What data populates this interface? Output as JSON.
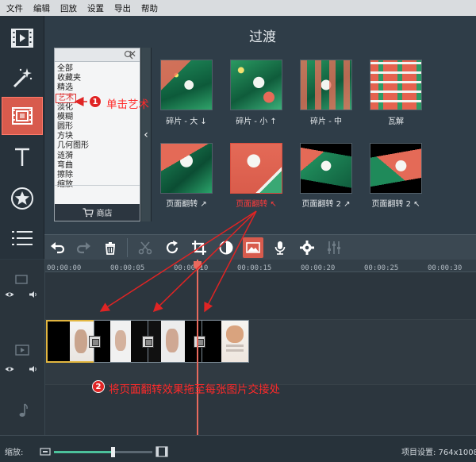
{
  "menu": [
    "文件",
    "编辑",
    "回放",
    "设置",
    "导出",
    "帮助"
  ],
  "left_tools": [
    "film-icon",
    "magic-wand-icon",
    "transition-icon",
    "text-icon",
    "star-icon",
    "list-icon"
  ],
  "panel": {
    "title": "过渡",
    "categories": [
      "全部",
      "收藏夹",
      "精选",
      "艺术",
      "淡化",
      "模糊",
      "圆形",
      "方块",
      "几何图形",
      "涟漪",
      "弯曲",
      "擦除",
      "缩放"
    ],
    "selected_category": "艺术",
    "shop_label": "商店",
    "collapse_arrow": "‹",
    "transitions": [
      {
        "label": "碎片 - 大 ↓"
      },
      {
        "label": "碎片 - 小 ↑"
      },
      {
        "label": "碎片 - 中"
      },
      {
        "label": "瓦解"
      },
      {
        "label": "页面翻转 ↗"
      },
      {
        "label": "页面翻转 ↖"
      },
      {
        "label": "页面翻转 2 ↗"
      },
      {
        "label": "页面翻转 2 ↖"
      }
    ]
  },
  "edit_tools": [
    "undo-icon",
    "redo-icon",
    "delete-icon",
    "cut-icon",
    "rotate-icon",
    "crop-icon",
    "color-adjust-icon",
    "image-icon",
    "microphone-icon",
    "settings-icon",
    "equalizer-icon"
  ],
  "timeline": {
    "ticks": [
      "00:00:00",
      "00:00:05",
      "00:00:10",
      "00:00:15",
      "00:00:20",
      "00:00:25",
      "00:00:30"
    ]
  },
  "status": {
    "zoom_label": "缩放:",
    "zoom_fraction": 0.6,
    "project_settings": "项目设置: 764x1008"
  },
  "annotations": {
    "step1_num": "1",
    "step1_text": "单击艺术",
    "step2_num": "2",
    "step2_text": "将页面翻转效果拖至每张图片交接处"
  }
}
